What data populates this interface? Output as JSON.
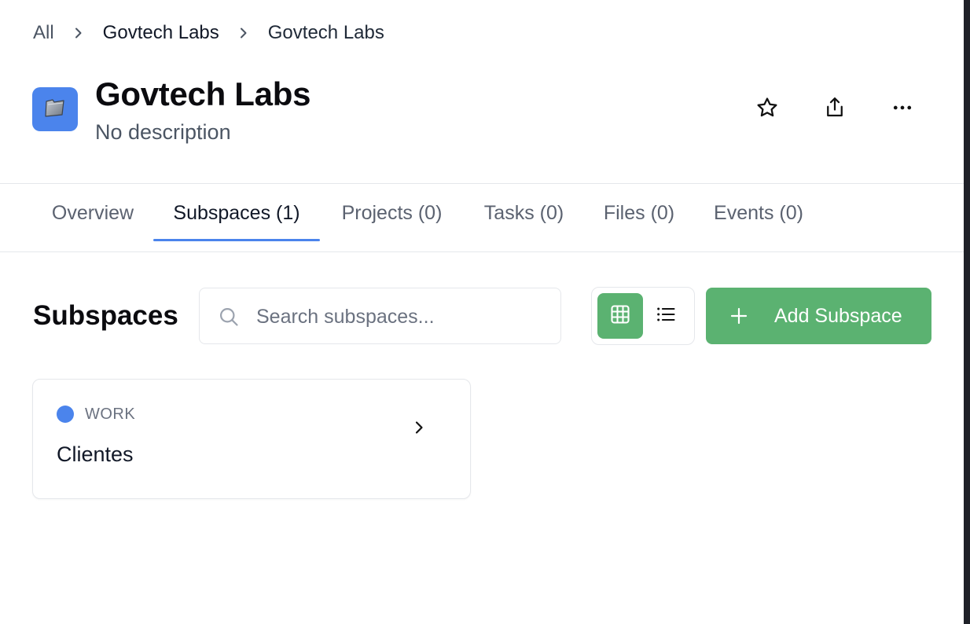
{
  "breadcrumb": {
    "items": [
      "All",
      "Govtech Labs",
      "Govtech Labs"
    ]
  },
  "header": {
    "title": "Govtech Labs",
    "description": "No description",
    "icon": "folder-icon",
    "icon_color": "#4b84ec",
    "actions": [
      "star-icon",
      "share-icon",
      "more-icon"
    ]
  },
  "tabs": [
    {
      "label": "Overview",
      "active": false
    },
    {
      "label": "Subspaces (1)",
      "active": true
    },
    {
      "label": "Projects (0)",
      "active": false
    },
    {
      "label": "Tasks (0)",
      "active": false
    },
    {
      "label": "Files (0)",
      "active": false
    },
    {
      "label": "Events (0)",
      "active": false
    }
  ],
  "subspaces": {
    "title": "Subspaces",
    "search_placeholder": "Search subspaces...",
    "search_value": "",
    "view_mode": "grid",
    "add_button_label": "Add Subspace",
    "accent_color": "#5bb271",
    "items": [
      {
        "type": "WORK",
        "name": "Clientes",
        "dot_color": "#4b84ec"
      }
    ]
  }
}
